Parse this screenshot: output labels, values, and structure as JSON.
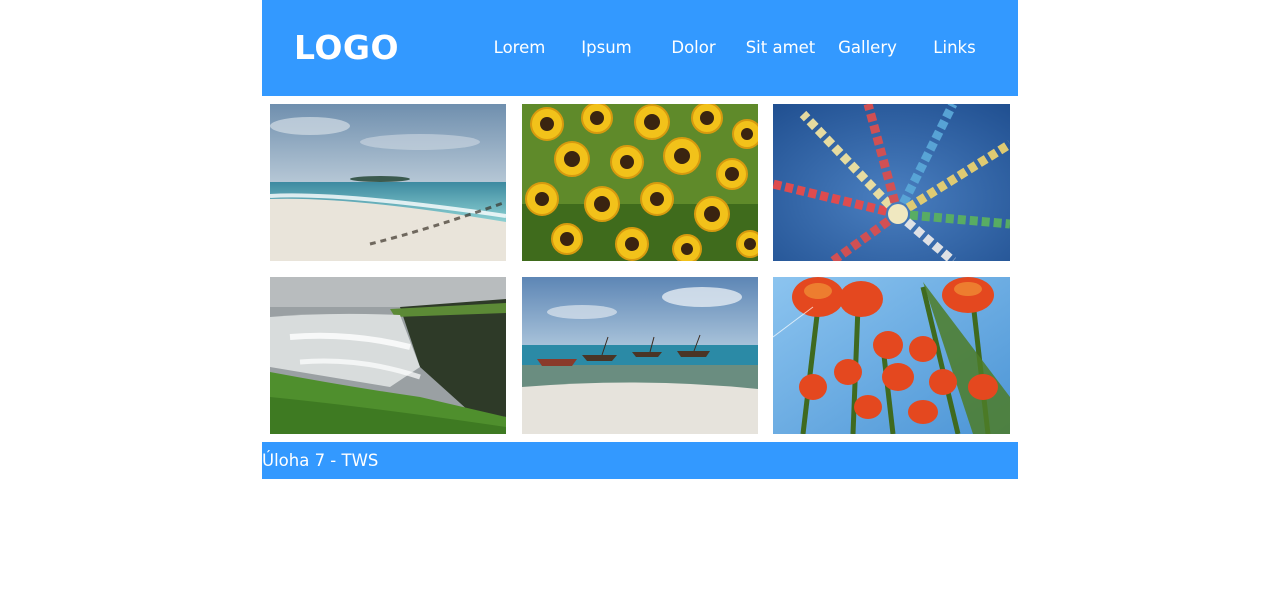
{
  "header": {
    "logo": "LOGO",
    "nav": [
      "Lorem",
      "Ipsum",
      "Dolor",
      "Sit amet",
      "Gallery",
      "Links"
    ]
  },
  "gallery": {
    "images": [
      "beach-photo",
      "sunflowers-photo",
      "prayer-flags-photo",
      "waterfall-photo",
      "boats-on-beach-photo",
      "tulips-photo"
    ]
  },
  "footer": {
    "text": "Úloha 7 - TWS"
  },
  "colors": {
    "accent": "#3399ff",
    "text_on_accent": "#ffffff",
    "background": "#ffffff"
  }
}
